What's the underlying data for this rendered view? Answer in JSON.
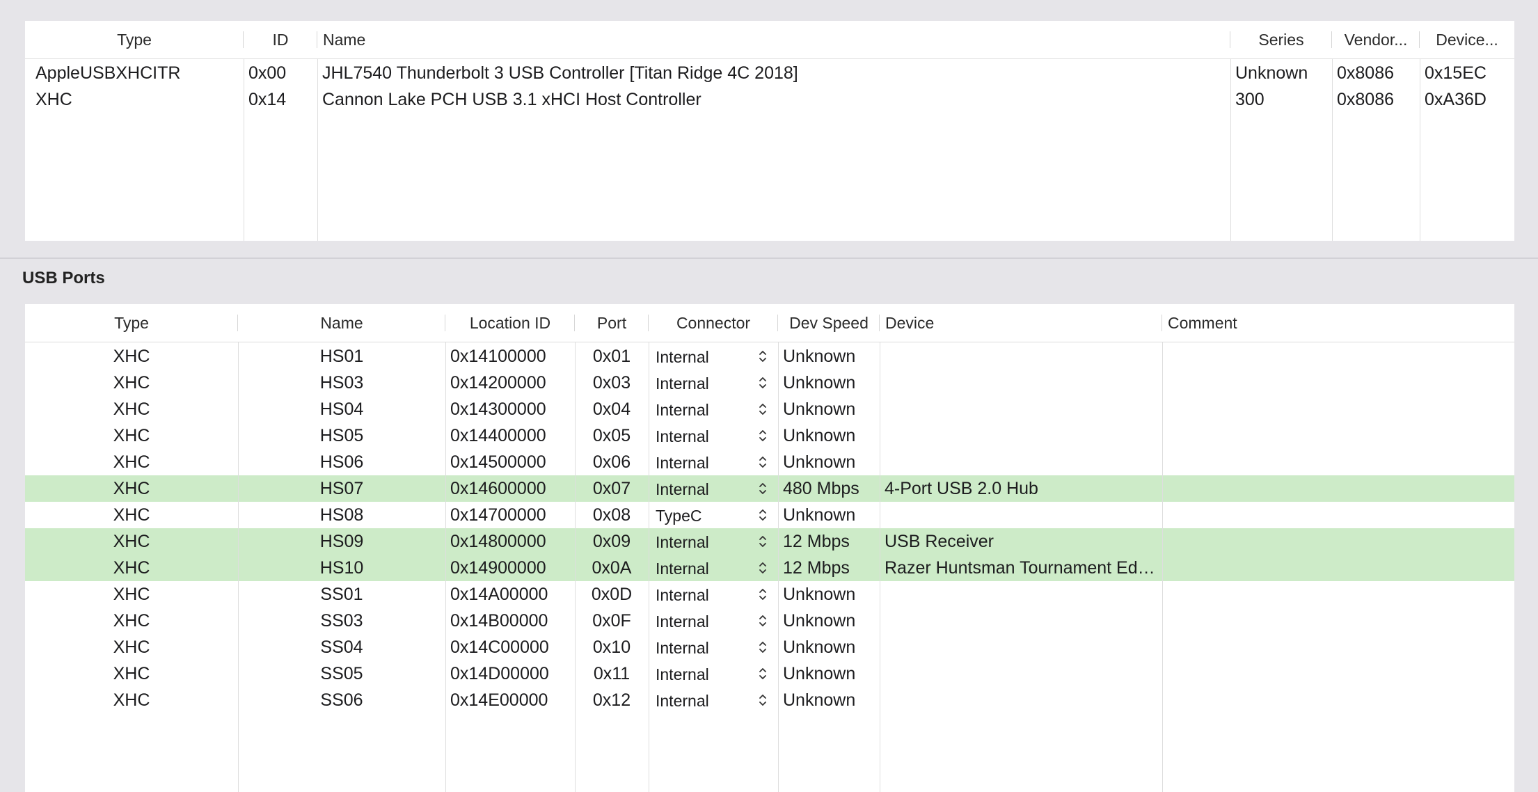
{
  "controllers": {
    "columns": [
      "Type",
      "ID",
      "Name",
      "Series",
      "Vendor...",
      "Device..."
    ],
    "rows": [
      {
        "type": "AppleUSBXHCITR",
        "id": "0x00",
        "name": "JHL7540 Thunderbolt 3 USB Controller [Titan Ridge 4C 2018]",
        "series": "Unknown",
        "vendor": "0x8086",
        "device": "0x15EC"
      },
      {
        "type": "XHC",
        "id": "0x14",
        "name": "Cannon Lake PCH USB 3.1 xHCI Host Controller",
        "series": "300",
        "vendor": "0x8086",
        "device": "0xA36D"
      }
    ]
  },
  "ports_section": {
    "title": "USB Ports"
  },
  "ports": {
    "columns": [
      "Type",
      "Name",
      "Location ID",
      "Port",
      "Connector",
      "Dev Speed",
      "Device",
      "Comment"
    ],
    "rows": [
      {
        "type": "XHC",
        "name": "HS01",
        "location": "0x14100000",
        "port": "0x01",
        "connector": "Internal",
        "speed": "Unknown",
        "device": "",
        "comment": "",
        "active": false
      },
      {
        "type": "XHC",
        "name": "HS03",
        "location": "0x14200000",
        "port": "0x03",
        "connector": "Internal",
        "speed": "Unknown",
        "device": "",
        "comment": "",
        "active": false
      },
      {
        "type": "XHC",
        "name": "HS04",
        "location": "0x14300000",
        "port": "0x04",
        "connector": "Internal",
        "speed": "Unknown",
        "device": "",
        "comment": "",
        "active": false
      },
      {
        "type": "XHC",
        "name": "HS05",
        "location": "0x14400000",
        "port": "0x05",
        "connector": "Internal",
        "speed": "Unknown",
        "device": "",
        "comment": "",
        "active": false
      },
      {
        "type": "XHC",
        "name": "HS06",
        "location": "0x14500000",
        "port": "0x06",
        "connector": "Internal",
        "speed": "Unknown",
        "device": "",
        "comment": "",
        "active": false
      },
      {
        "type": "XHC",
        "name": "HS07",
        "location": "0x14600000",
        "port": "0x07",
        "connector": "Internal",
        "speed": "480 Mbps",
        "device": "4-Port USB 2.0 Hub",
        "comment": "",
        "active": true
      },
      {
        "type": "XHC",
        "name": "HS08",
        "location": "0x14700000",
        "port": "0x08",
        "connector": "TypeC",
        "speed": "Unknown",
        "device": "",
        "comment": "",
        "active": false
      },
      {
        "type": "XHC",
        "name": "HS09",
        "location": "0x14800000",
        "port": "0x09",
        "connector": "Internal",
        "speed": "12 Mbps",
        "device": "USB Receiver",
        "comment": "",
        "active": true
      },
      {
        "type": "XHC",
        "name": "HS10",
        "location": "0x14900000",
        "port": "0x0A",
        "connector": "Internal",
        "speed": "12 Mbps",
        "device": "Razer Huntsman Tournament Edi…",
        "comment": "",
        "active": true
      },
      {
        "type": "XHC",
        "name": "SS01",
        "location": "0x14A00000",
        "port": "0x0D",
        "connector": "Internal",
        "speed": "Unknown",
        "device": "",
        "comment": "",
        "active": false
      },
      {
        "type": "XHC",
        "name": "SS03",
        "location": "0x14B00000",
        "port": "0x0F",
        "connector": "Internal",
        "speed": "Unknown",
        "device": "",
        "comment": "",
        "active": false
      },
      {
        "type": "XHC",
        "name": "SS04",
        "location": "0x14C00000",
        "port": "0x10",
        "connector": "Internal",
        "speed": "Unknown",
        "device": "",
        "comment": "",
        "active": false
      },
      {
        "type": "XHC",
        "name": "SS05",
        "location": "0x14D00000",
        "port": "0x11",
        "connector": "Internal",
        "speed": "Unknown",
        "device": "",
        "comment": "",
        "active": false
      },
      {
        "type": "XHC",
        "name": "SS06",
        "location": "0x14E00000",
        "port": "0x12",
        "connector": "Internal",
        "speed": "Unknown",
        "device": "",
        "comment": "",
        "active": false
      }
    ]
  },
  "colors": {
    "active_row": "#cdebc8",
    "background": "#e6e5e9"
  },
  "icons": {
    "connector_popup": "chevron-up-down-icon"
  }
}
